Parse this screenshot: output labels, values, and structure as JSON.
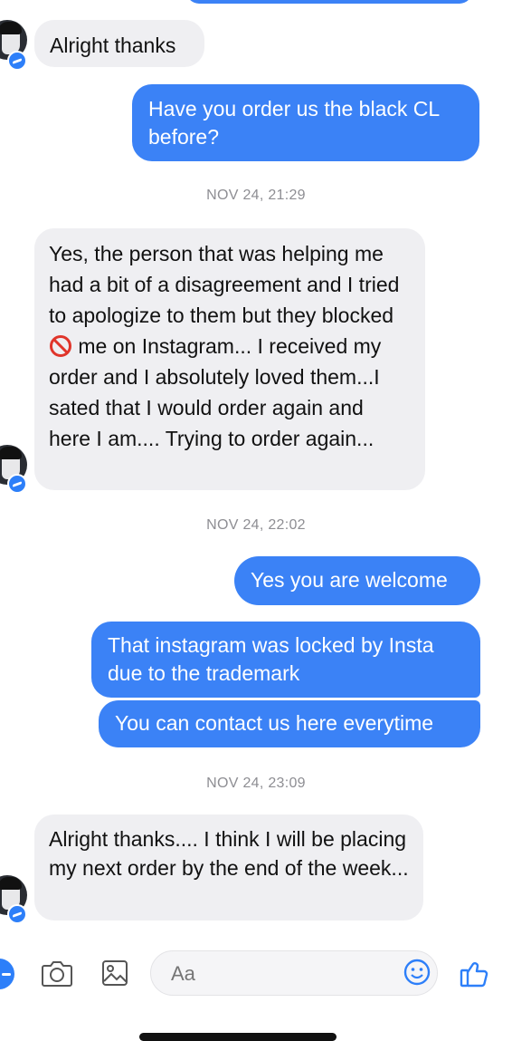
{
  "messages": [
    {
      "text": "Alright thanks"
    },
    {
      "text": "Have you order us the black CL before?"
    },
    {
      "stamp": "NOV 24, 21:29"
    },
    {
      "pre": "Yes, the person that was helping me had a bit of a disagreement and I tried to apologize to them but they blocked ",
      "post": " me on Instagram... I received my order and I absolutely loved them...I sated that I would order again and here I am.... Trying to order again..."
    },
    {
      "stamp": "NOV 24, 22:02"
    },
    {
      "text": "Yes you are welcome"
    },
    {
      "text": "That instagram was locked by Insta due to the trademark"
    },
    {
      "text": "You can contact us here everytime"
    },
    {
      "stamp": "NOV 24, 23:09"
    },
    {
      "text": "Alright thanks.... I think I will be placing my next order by the end of the week..."
    }
  ],
  "composer": {
    "placeholder": "Aa"
  },
  "colors": {
    "outgoing": "#3b82f6",
    "incoming": "#efeff2",
    "stamp": "#8e8e93"
  },
  "icons": [
    "camera-icon",
    "gallery-icon",
    "emoji-icon",
    "thumbs-up-icon",
    "messenger-badge-icon",
    "no-entry-icon"
  ]
}
